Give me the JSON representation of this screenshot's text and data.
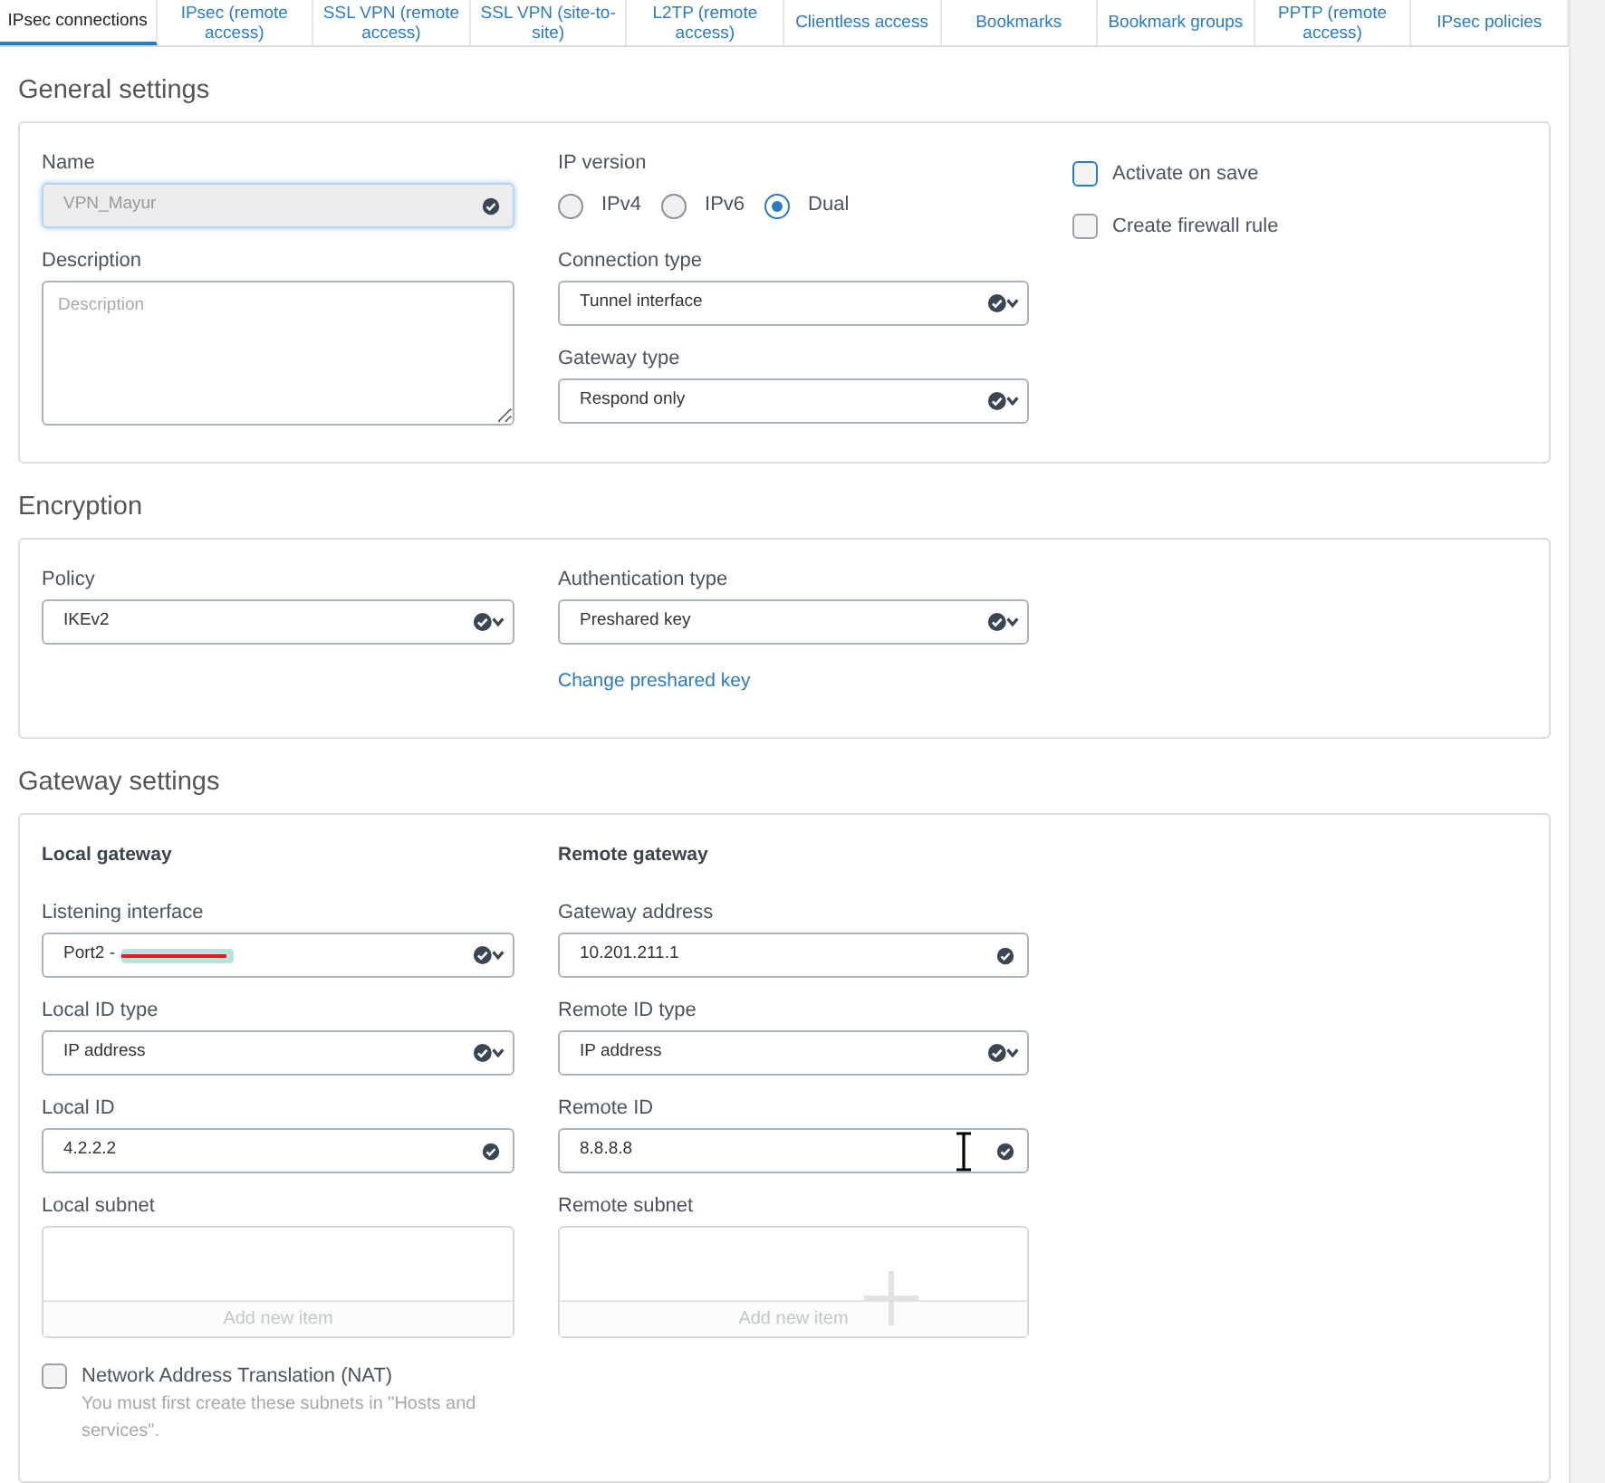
{
  "tabs": [
    {
      "label": "IPsec connections",
      "selected": true
    },
    {
      "label": "IPsec (remote access)",
      "selected": false
    },
    {
      "label": "SSL VPN (remote access)",
      "selected": false
    },
    {
      "label": "SSL VPN (site-to-site)",
      "selected": false
    },
    {
      "label": "L2TP (remote access)",
      "selected": false
    },
    {
      "label": "Clientless access",
      "selected": false
    },
    {
      "label": "Bookmarks",
      "selected": false
    },
    {
      "label": "Bookmark groups",
      "selected": false
    },
    {
      "label": "PPTP (remote access)",
      "selected": false
    },
    {
      "label": "IPsec policies",
      "selected": false
    }
  ],
  "general": {
    "title": "General settings",
    "name": {
      "label": "Name",
      "value": "VPN_Mayur",
      "disabled": true
    },
    "description": {
      "label": "Description",
      "placeholder": "Description"
    },
    "ip_version": {
      "label": "IP version",
      "options": [
        {
          "label": "IPv4",
          "selected": false
        },
        {
          "label": "IPv6",
          "selected": false
        },
        {
          "label": "Dual",
          "selected": true
        }
      ]
    },
    "connection_type": {
      "label": "Connection type",
      "value": "Tunnel interface"
    },
    "gateway_type": {
      "label": "Gateway type",
      "value": "Respond only"
    },
    "options": [
      {
        "label": "Activate on save",
        "checked": false,
        "focused": true
      },
      {
        "label": "Create firewall rule",
        "checked": false,
        "focused": false
      }
    ]
  },
  "encryption": {
    "title": "Encryption",
    "policy": {
      "label": "Policy",
      "value": "IKEv2"
    },
    "authentication_type": {
      "label": "Authentication type",
      "value": "Preshared key"
    },
    "link": "Change preshared key"
  },
  "gateway": {
    "title": "Gateway settings",
    "columns": [
      {
        "title": "Local gateway",
        "fields": [
          {
            "kind": "select",
            "label": "Listening interface",
            "value": "Port2 -",
            "redacted": true
          },
          {
            "kind": "select",
            "label": "Local ID type",
            "value": "IP address"
          },
          {
            "kind": "input",
            "label": "Local ID",
            "value": "4.2.2.2"
          },
          {
            "kind": "list",
            "label": "Local subnet",
            "button": "Add new item"
          }
        ]
      },
      {
        "title": "Remote gateway",
        "fields": [
          {
            "kind": "input",
            "label": "Gateway address",
            "value": "10.201.211.1"
          },
          {
            "kind": "select",
            "label": "Remote ID type",
            "value": "IP address"
          },
          {
            "kind": "input",
            "label": "Remote ID",
            "value": "8.8.8.8",
            "cursor": true
          },
          {
            "kind": "list",
            "label": "Remote subnet",
            "button": "Add new item",
            "add_hint": true
          }
        ]
      }
    ],
    "nat": {
      "label": "Network Address Translation (NAT)",
      "checked": false,
      "hint": "You must first create these subnets in \"Hosts and services\"."
    }
  }
}
